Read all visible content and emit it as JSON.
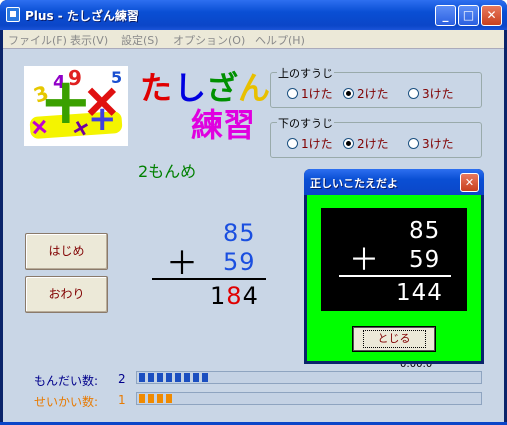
{
  "window": {
    "title": "Plus - たしざん練習",
    "minimize": "_",
    "maximize": "□",
    "close": "✕"
  },
  "menu": [
    "ファイル(F)",
    "表示(V)",
    "設定(S)",
    "オプション(O)",
    "ヘルプ(H)"
  ],
  "logo": {
    "glyphs": [
      "3",
      "9",
      "4",
      "5",
      "+",
      "+",
      "+"
    ]
  },
  "heading": {
    "line1": [
      "た",
      "し",
      "ざ",
      "ん"
    ],
    "line2": "練習"
  },
  "upper_digits": {
    "label": "上のすうじ",
    "options": [
      "1けた",
      "2けた",
      "3けた"
    ],
    "selected": "2けた"
  },
  "lower_digits": {
    "label": "下のすうじ",
    "options": [
      "1けた",
      "2けた",
      "3けた"
    ],
    "selected": "2けた"
  },
  "question": "2もんめ",
  "buttons": {
    "start": "はじめ",
    "end": "おわり"
  },
  "problem": {
    "top": "85",
    "bottom": "59",
    "operator": "＋",
    "answer_digits": [
      "1",
      "8",
      "4"
    ]
  },
  "stats": {
    "questions_label": "もんだい数:",
    "questions_value": "2",
    "questions_progress": 8,
    "correct_label": "せいかい数:",
    "correct_value": "1",
    "correct_progress": 4,
    "time_partial": "0:00:0"
  },
  "dialog": {
    "title": "正しいこたえだよ",
    "top": "85",
    "bottom": "59",
    "operator": "＋",
    "answer": "144",
    "close_label": "とじる",
    "close_glyph": "✕"
  },
  "colors": {
    "titlebar": "#0a4fd4",
    "client": "#c9d6e6",
    "dialog_bg": "#00ff00",
    "progress_blue": "#1c4fc0",
    "progress_orange": "#f08a00"
  }
}
